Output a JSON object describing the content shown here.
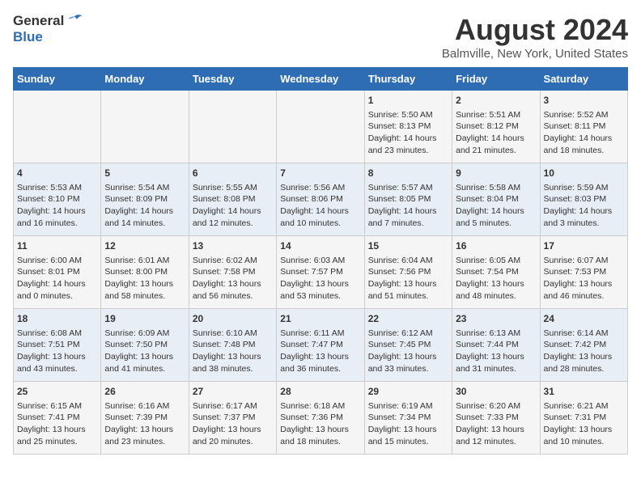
{
  "header": {
    "logo_general": "General",
    "logo_blue": "Blue",
    "month": "August 2024",
    "location": "Balmville, New York, United States"
  },
  "days_of_week": [
    "Sunday",
    "Monday",
    "Tuesday",
    "Wednesday",
    "Thursday",
    "Friday",
    "Saturday"
  ],
  "weeks": [
    {
      "cells": [
        {
          "day": "",
          "content": ""
        },
        {
          "day": "",
          "content": ""
        },
        {
          "day": "",
          "content": ""
        },
        {
          "day": "",
          "content": ""
        },
        {
          "day": "1",
          "content": "Sunrise: 5:50 AM\nSunset: 8:13 PM\nDaylight: 14 hours\nand 23 minutes."
        },
        {
          "day": "2",
          "content": "Sunrise: 5:51 AM\nSunset: 8:12 PM\nDaylight: 14 hours\nand 21 minutes."
        },
        {
          "day": "3",
          "content": "Sunrise: 5:52 AM\nSunset: 8:11 PM\nDaylight: 14 hours\nand 18 minutes."
        }
      ]
    },
    {
      "cells": [
        {
          "day": "4",
          "content": "Sunrise: 5:53 AM\nSunset: 8:10 PM\nDaylight: 14 hours\nand 16 minutes."
        },
        {
          "day": "5",
          "content": "Sunrise: 5:54 AM\nSunset: 8:09 PM\nDaylight: 14 hours\nand 14 minutes."
        },
        {
          "day": "6",
          "content": "Sunrise: 5:55 AM\nSunset: 8:08 PM\nDaylight: 14 hours\nand 12 minutes."
        },
        {
          "day": "7",
          "content": "Sunrise: 5:56 AM\nSunset: 8:06 PM\nDaylight: 14 hours\nand 10 minutes."
        },
        {
          "day": "8",
          "content": "Sunrise: 5:57 AM\nSunset: 8:05 PM\nDaylight: 14 hours\nand 7 minutes."
        },
        {
          "day": "9",
          "content": "Sunrise: 5:58 AM\nSunset: 8:04 PM\nDaylight: 14 hours\nand 5 minutes."
        },
        {
          "day": "10",
          "content": "Sunrise: 5:59 AM\nSunset: 8:03 PM\nDaylight: 14 hours\nand 3 minutes."
        }
      ]
    },
    {
      "cells": [
        {
          "day": "11",
          "content": "Sunrise: 6:00 AM\nSunset: 8:01 PM\nDaylight: 14 hours\nand 0 minutes."
        },
        {
          "day": "12",
          "content": "Sunrise: 6:01 AM\nSunset: 8:00 PM\nDaylight: 13 hours\nand 58 minutes."
        },
        {
          "day": "13",
          "content": "Sunrise: 6:02 AM\nSunset: 7:58 PM\nDaylight: 13 hours\nand 56 minutes."
        },
        {
          "day": "14",
          "content": "Sunrise: 6:03 AM\nSunset: 7:57 PM\nDaylight: 13 hours\nand 53 minutes."
        },
        {
          "day": "15",
          "content": "Sunrise: 6:04 AM\nSunset: 7:56 PM\nDaylight: 13 hours\nand 51 minutes."
        },
        {
          "day": "16",
          "content": "Sunrise: 6:05 AM\nSunset: 7:54 PM\nDaylight: 13 hours\nand 48 minutes."
        },
        {
          "day": "17",
          "content": "Sunrise: 6:07 AM\nSunset: 7:53 PM\nDaylight: 13 hours\nand 46 minutes."
        }
      ]
    },
    {
      "cells": [
        {
          "day": "18",
          "content": "Sunrise: 6:08 AM\nSunset: 7:51 PM\nDaylight: 13 hours\nand 43 minutes."
        },
        {
          "day": "19",
          "content": "Sunrise: 6:09 AM\nSunset: 7:50 PM\nDaylight: 13 hours\nand 41 minutes."
        },
        {
          "day": "20",
          "content": "Sunrise: 6:10 AM\nSunset: 7:48 PM\nDaylight: 13 hours\nand 38 minutes."
        },
        {
          "day": "21",
          "content": "Sunrise: 6:11 AM\nSunset: 7:47 PM\nDaylight: 13 hours\nand 36 minutes."
        },
        {
          "day": "22",
          "content": "Sunrise: 6:12 AM\nSunset: 7:45 PM\nDaylight: 13 hours\nand 33 minutes."
        },
        {
          "day": "23",
          "content": "Sunrise: 6:13 AM\nSunset: 7:44 PM\nDaylight: 13 hours\nand 31 minutes."
        },
        {
          "day": "24",
          "content": "Sunrise: 6:14 AM\nSunset: 7:42 PM\nDaylight: 13 hours\nand 28 minutes."
        }
      ]
    },
    {
      "cells": [
        {
          "day": "25",
          "content": "Sunrise: 6:15 AM\nSunset: 7:41 PM\nDaylight: 13 hours\nand 25 minutes."
        },
        {
          "day": "26",
          "content": "Sunrise: 6:16 AM\nSunset: 7:39 PM\nDaylight: 13 hours\nand 23 minutes."
        },
        {
          "day": "27",
          "content": "Sunrise: 6:17 AM\nSunset: 7:37 PM\nDaylight: 13 hours\nand 20 minutes."
        },
        {
          "day": "28",
          "content": "Sunrise: 6:18 AM\nSunset: 7:36 PM\nDaylight: 13 hours\nand 18 minutes."
        },
        {
          "day": "29",
          "content": "Sunrise: 6:19 AM\nSunset: 7:34 PM\nDaylight: 13 hours\nand 15 minutes."
        },
        {
          "day": "30",
          "content": "Sunrise: 6:20 AM\nSunset: 7:33 PM\nDaylight: 13 hours\nand 12 minutes."
        },
        {
          "day": "31",
          "content": "Sunrise: 6:21 AM\nSunset: 7:31 PM\nDaylight: 13 hours\nand 10 minutes."
        }
      ]
    }
  ]
}
